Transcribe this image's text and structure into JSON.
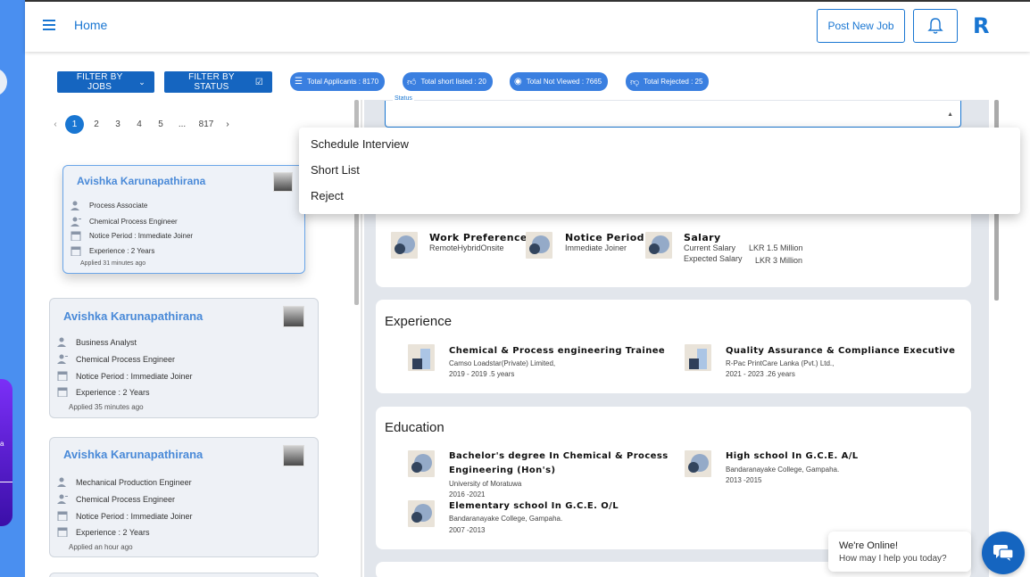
{
  "header": {
    "title": "Home",
    "post_job_label": "Post New Job",
    "logo_text": "R",
    "brand_color": "#1976d2"
  },
  "filters": {
    "by_jobs": "FILTER BY JOBS",
    "by_status": "FILTER BY STATUS"
  },
  "stats": {
    "total_applicants": "Total Applicants : 8170",
    "total_shortlisted": "Total short listed : 20",
    "total_not_viewed": "Total Not Viewed : 7665",
    "total_rejected": "Total Rejected : 25"
  },
  "pagination": {
    "pages": [
      "1",
      "2",
      "3",
      "4",
      "5",
      "...",
      "817"
    ],
    "active": "1",
    "prev": "‹",
    "next": "›"
  },
  "applicants": [
    {
      "name": "Avishka Karunapathirana",
      "current_role": "Process Associate",
      "applied_for": "Chemical Process Engineer",
      "notice": "Notice Period : Immediate Joiner",
      "experience": "Experience : 2 Years",
      "applied": "Applied 31 minutes ago"
    },
    {
      "name": "Avishka Karunapathirana",
      "current_role": "Business Analyst",
      "applied_for": "Chemical Process Engineer",
      "notice": "Notice Period : Immediate Joiner",
      "experience": "Experience : 2 Years",
      "applied": "Applied 35 minutes ago"
    },
    {
      "name": "Avishka Karunapathirana",
      "current_role": "Mechanical Production Engineer",
      "applied_for": "Chemical Process Engineer",
      "notice": "Notice Period : Immediate Joiner",
      "experience": "Experience : 2 Years",
      "applied": "Applied an hour ago"
    }
  ],
  "status_field": {
    "legend": "Status"
  },
  "status_menu": {
    "options": [
      "Schedule Interview",
      "Short List",
      "Reject"
    ]
  },
  "preferences": {
    "work_title": "Work Preference",
    "work_value": "RemoteHybridOnsite",
    "notice_title": "Notice Period",
    "notice_value": "Immediate Joiner",
    "salary_title": "Salary",
    "current_salary_label": "Current Salary",
    "current_salary_value": "LKR 1.5 Million",
    "expected_salary_label": "Expected Salary",
    "expected_salary_value": "LKR 3 Million"
  },
  "experience": {
    "title": "Experience",
    "items": [
      {
        "role": "Chemical & Process engineering Trainee",
        "company": "Camso Loadstar(Private) Limited,",
        "period": "2019 - 2019 .5 years"
      },
      {
        "role": "Quality Assurance & Compliance Executive",
        "company": "R-Pac PrintCare Lanka (Pvt.) Ltd.,",
        "period": "2021 - 2023 .26 years"
      }
    ]
  },
  "education": {
    "title": "Education",
    "items": [
      {
        "degree_line1": "Bachelor's degree In Chemical & Process",
        "degree_line2": "Engineering (Hon's)",
        "school": "University of Moratuwa",
        "period": "2016 -2021"
      },
      {
        "degree_line1": "High school In G.C.E. A/L",
        "school": "Bandaranayake College, Gampaha.",
        "period": "2013 -2015"
      },
      {
        "degree_line1": "Elementary school In G.C.E. O/L",
        "school": "Bandaranayake College, Gampaha.",
        "period": "2007 -2013"
      }
    ]
  },
  "chat": {
    "online": "We're Online!",
    "help": "How may I help you today?"
  }
}
